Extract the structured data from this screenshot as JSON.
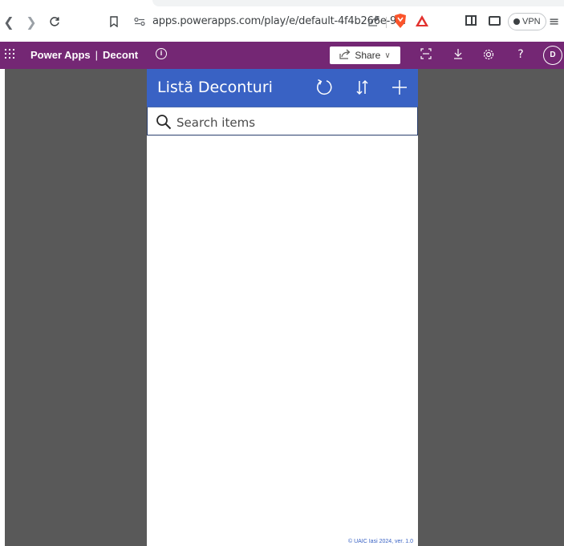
{
  "browser": {
    "url": "apps.powerapps.com/play/e/default-4f4b266e-9...",
    "vpn_label": "VPN",
    "rewards_badge": "10"
  },
  "header": {
    "app_name": "Power Apps",
    "separator": "|",
    "env_name": "Decont",
    "share_label": "Share",
    "avatar_initial": "D",
    "help_glyph": "?"
  },
  "app": {
    "title": "Listă Deconturi",
    "search_placeholder": "Search items",
    "footer": "© UAIC Iasi 2024, ver. 1.0"
  },
  "colors": {
    "header_purple": "#742774",
    "app_blue": "#3962c4",
    "player_background": "#595959"
  }
}
